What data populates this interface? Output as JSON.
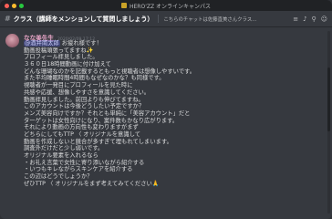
{
  "app": {
    "title": "HERO'ZZ オンラインキャンパス"
  },
  "channel": {
    "name": "クラス（講師をメンションして質問しましょう）",
    "topic": "こちらのチャットは佐藤直美さんクラス..."
  },
  "message": {
    "username": "なな美先生",
    "timestamp": "2020/02/09 17:12",
    "mention": "@酒井南太郎",
    "first_line_rest": " お疲れ様です！",
    "lines": [
      "動画投稿頑張ってますね✨",
      "プロフィール拝見しました。",
      "３６０日18時間動画に付け加えて",
      "どんな珊瑚なのかを記載するともっと視聴者は想像しやすいです。",
      "また平均睡眠時間4時間もなぜなのかな？も同様です。",
      "視聴者が一発目にプロフィールを見た時に",
      "共感や応援、想像しやすさを意識してください。",
      "動画拝見しました。前回よりも伸びてますね。",
      "このアカウントは今後どうしたい予定ですか？",
      "メンズ美容向けですか？それとも単純に「美容アカウント」だと",
      "ターゲットは女性向けになり、案件数もかなり広がります。",
      "それにより動画の方向性も変わりますがまず",
      "どちらにしてもTTP 〈 オリジナルを意識して",
      "動画を作成しないと競合が多すぎて埋もれてしまいます。",
      "調査外だけだと少し弱いです。",
      "オリジナル要素を入れるなら",
      "・お礼え言葉で女性に寄り添いながら紹介する",
      "・いつもキレながらスキンケアを紹介する",
      "この辺はどうでしょうか？",
      "ぜひTTP 〈 オリジナルをまず考えてみてください🙏"
    ]
  },
  "icons": {
    "channel": "hash-icon",
    "threads": "threads-icon",
    "bell": "bell-icon",
    "pin": "pin-icon",
    "members": "members-icon"
  }
}
